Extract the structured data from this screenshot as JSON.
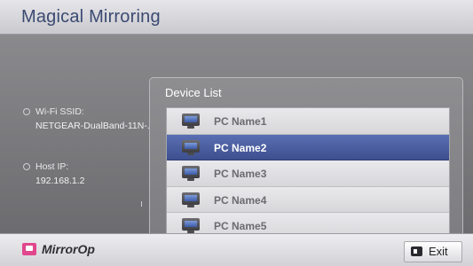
{
  "header": {
    "title": "Magical Mirroring"
  },
  "info": {
    "wifi_label": "Wi-Fi SSID:",
    "wifi_value": "NETGEAR-DualBand-11N-...",
    "host_label": "Host IP:",
    "host_value": "192.168.1.2"
  },
  "device_list": {
    "title": "Device List",
    "items": [
      {
        "label": "PC Name1",
        "selected": false,
        "icon": "monitor-icon"
      },
      {
        "label": "PC Name2",
        "selected": true,
        "icon": "monitor-icon"
      },
      {
        "label": "PC Name3",
        "selected": false,
        "icon": "monitor-icon"
      },
      {
        "label": "PC Name4",
        "selected": false,
        "icon": "monitor-icon"
      },
      {
        "label": "PC Name5",
        "selected": false,
        "icon": "monitor-icon"
      }
    ]
  },
  "footer": {
    "logo_text": "MirrorOp",
    "exit_label": "Exit",
    "logo_icon": "mirrorop-logo-icon",
    "exit_icon": "remote-key-icon"
  },
  "colors": {
    "title": "#3b4a72",
    "selected": "#4a5ea3",
    "logo": "#e0478c"
  }
}
